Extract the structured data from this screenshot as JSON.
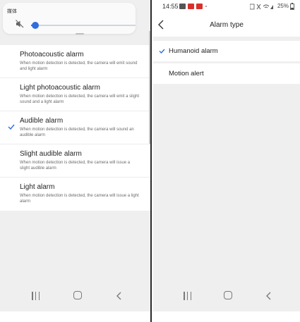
{
  "left_screen": {
    "volume_panel": {
      "title": "媒体",
      "muted_icon": "speaker-mute-icon",
      "media_volume_level": 0.03
    },
    "options": [
      {
        "title": "Photoacoustic alarm",
        "description": "When motion detection is detected, the camera will emit sound and light alarm",
        "selected": false
      },
      {
        "title": "Light photoacoustic alarm",
        "description": "When motion detection is detected, the camera will emit a slight sound and a light alarm",
        "selected": false
      },
      {
        "title": "Audible alarm",
        "description": "When motion detection is detected, the camera will sound an audible alarm",
        "selected": true
      },
      {
        "title": "Slight audible alarm",
        "description": "When motion detection is detected, the camera will issue a slight audible alarm",
        "selected": false
      },
      {
        "title": "Light alarm",
        "description": "When motion detection is detected, the camera will issue a light alarm",
        "selected": false
      }
    ],
    "accent_color": "#2f6fdc"
  },
  "right_screen": {
    "status_bar": {
      "time": "14:55",
      "battery": "25%"
    },
    "page_title": "Alarm type",
    "rows": [
      {
        "label": "Humanoid alarm",
        "selected": true
      },
      {
        "label": "Motion alert",
        "selected": false
      }
    ],
    "accent_color": "#2f6fdc"
  },
  "nav_bar_icons": [
    "recent-apps-icon",
    "home-icon",
    "back-icon"
  ]
}
